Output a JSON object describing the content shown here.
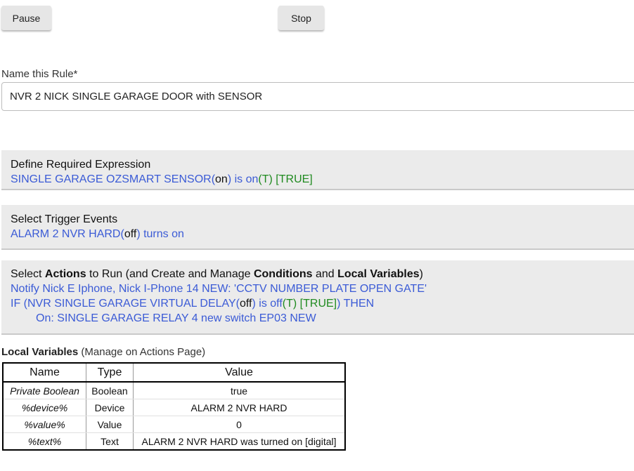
{
  "controls": {
    "pause_label": "Pause",
    "stop_label": "Stop"
  },
  "rule_name": {
    "label": "Name this Rule*",
    "value": "NVR 2 NICK SINGLE GARAGE DOOR with SENSOR"
  },
  "required_expression": {
    "title": "Define Required Expression",
    "device": "SINGLE GARAGE OZSMART SENSOR(",
    "state": "on",
    "condition": ") is on",
    "truth": "(T)",
    "result": "[TRUE]"
  },
  "trigger_events": {
    "title": "Select Trigger Events",
    "device": "ALARM 2 NVR HARD(",
    "state": "off",
    "event": ") turns on"
  },
  "actions": {
    "title_1": "Select ",
    "title_actions": "Actions",
    "title_2": " to Run (and Create and Manage ",
    "title_conditions": "Conditions",
    "title_3": " and ",
    "title_local_vars": "Local Variables",
    "title_4": ")",
    "notify": "Notify Nick E Iphone, Nick I-Phone 14 NEW: 'CCTV NUMBER PLATE OPEN GATE'",
    "if_prefix": "IF (NVR SINGLE GARAGE VIRTUAL DELAY(",
    "if_state": "off",
    "if_condition": ") is off",
    "if_truth": "(T)",
    "if_result": "[TRUE]",
    "if_suffix": ") THEN",
    "on_action": "On: SINGLE GARAGE RELAY 4 new switch EP03 NEW"
  },
  "local_variables": {
    "title": "Local Variables",
    "subtitle": " (Manage on Actions Page)",
    "headers": [
      "Name",
      "Type",
      "Value"
    ],
    "rows": [
      {
        "name": "Private Boolean",
        "type": "Boolean",
        "value": "true"
      },
      {
        "name": "%device%",
        "type": "Device",
        "value": "ALARM 2 NVR HARD"
      },
      {
        "name": "%value%",
        "type": "Value",
        "value": "0"
      },
      {
        "name": "%text%",
        "type": "Text",
        "value": "ALARM 2 NVR HARD was turned on [digital]"
      }
    ]
  }
}
